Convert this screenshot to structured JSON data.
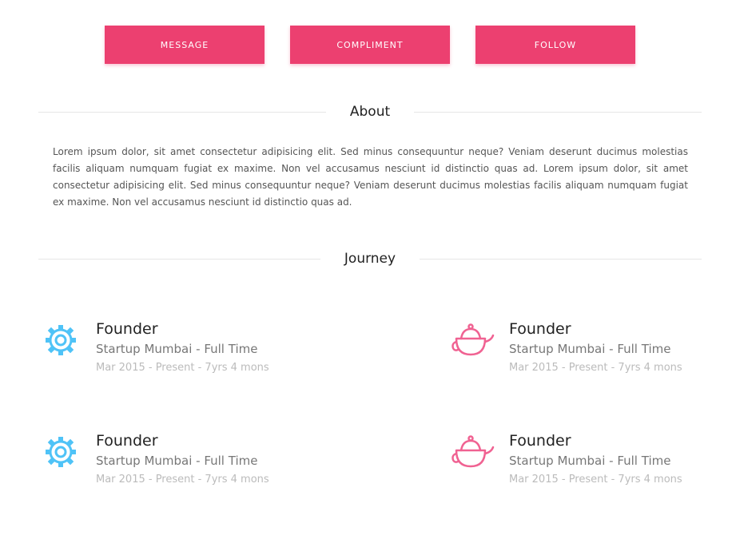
{
  "actions": {
    "message_label": "Message",
    "compliment_label": "Compliment",
    "follow_label": "Follow"
  },
  "about": {
    "title": "About",
    "text": "Lorem ipsum dolor, sit amet consectetur adipisicing elit. Sed minus consequuntur neque? Veniam deserunt ducimus molestias facilis aliquam numquam fugiat ex maxime. Non vel accusamus nesciunt id distinctio quas ad. Lorem ipsum dolor, sit amet consectetur adipisicing elit. Sed minus consequuntur neque? Veniam deserunt ducimus molestias facilis aliquam numquam fugiat ex maxime. Non vel accusamus nesciunt id distinctio quas ad."
  },
  "journey": {
    "title": "Journey",
    "items": [
      {
        "role": "Founder",
        "company": "Startup Mumbai - Full Time",
        "period": "Mar 2015 - Present - 7yrs 4 mons",
        "icon": "gear-icon"
      },
      {
        "role": "Founder",
        "company": "Startup Mumbai - Full Time",
        "period": "Mar 2015 - Present - 7yrs 4 mons",
        "icon": "teapot-icon"
      },
      {
        "role": "Founder",
        "company": "Startup Mumbai - Full Time",
        "period": "Mar 2015 - Present - 7yrs 4 mons",
        "icon": "gear-icon"
      },
      {
        "role": "Founder",
        "company": "Startup Mumbai - Full Time",
        "period": "Mar 2015 - Present - 7yrs 4 mons",
        "icon": "teapot-icon"
      }
    ]
  },
  "colors": {
    "accent": "#ec4070",
    "gear": "#4fc3f7",
    "teapot": "#f06292"
  }
}
